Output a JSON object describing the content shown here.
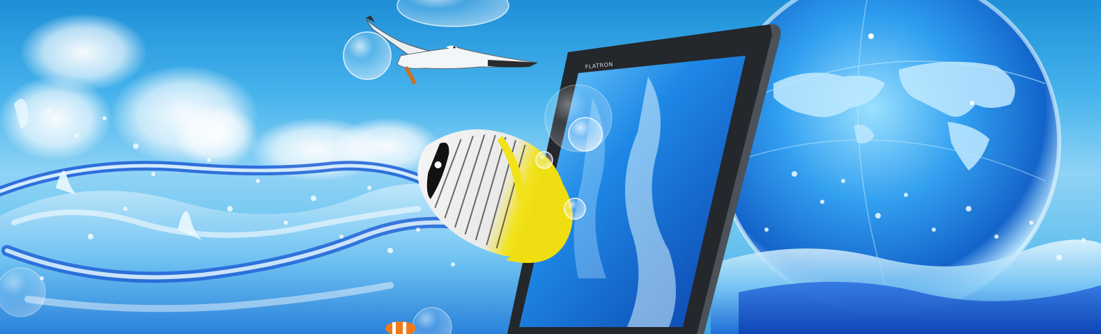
{
  "scene": {
    "description_colors": {
      "sky_top": "#1e8fd8",
      "sky_mid": "#8fd3f5",
      "water_deep": "#1a5fd0",
      "water_light": "#cfeefe",
      "fish_yellow": "#f2e21a",
      "monitor_frame": "#2a2d31",
      "globe_blue": "#1f7fe0"
    },
    "monitor": {
      "brand_text": "FLATRON"
    },
    "icons": {
      "bird": "seagull-icon",
      "fish": "butterflyfish-icon",
      "globe": "earth-globe-icon",
      "bubble": "bubble-icon",
      "monitor": "monitor-icon"
    }
  }
}
